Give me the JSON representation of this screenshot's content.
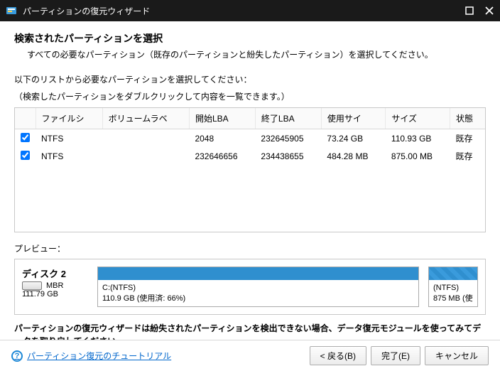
{
  "titlebar": {
    "title": "パーティションの復元ウィザード"
  },
  "header": {
    "heading": "検索されたパーティションを選択",
    "subheading": "すべての必要なパーティション（既存のパーティションと紛失したパーティション）を選択してください。"
  },
  "instruction": {
    "line1": "以下のリストから必要なパーティションを選択してください：",
    "line2": "（検索したパーティションをダブルクリックして内容を一覧できます。）"
  },
  "table": {
    "headers": [
      "ファイルシ",
      "ボリュームラベ",
      "開始LBA",
      "終了LBA",
      "使用サイ",
      "サイズ",
      "状態"
    ],
    "rows": [
      {
        "checked": true,
        "fs": "NTFS",
        "label": "",
        "start": "2048",
        "end": "232645905",
        "used": "73.24 GB",
        "size": "110.93 GB",
        "status": "既存"
      },
      {
        "checked": true,
        "fs": "NTFS",
        "label": "",
        "start": "232646656",
        "end": "234438655",
        "used": "484.28 MB",
        "size": "875.00 MB",
        "status": "既存"
      }
    ]
  },
  "preview": {
    "label": "プレビュー：",
    "disk": {
      "name": "ディスク 2",
      "type": "MBR",
      "size": "111.79 GB"
    },
    "partitions": [
      {
        "title": "C:(NTFS)",
        "detail": "110.9 GB (使用済: 66%)"
      },
      {
        "title": "(NTFS)",
        "detail": "875 MB (使"
      }
    ]
  },
  "note": "パーティションの復元ウィザードは紛失されたパーティションを検出できない場合、データ復元モジュールを使ってみてデータを取り戻してください。",
  "footer": {
    "help": "パーティション復元のチュートリアル",
    "back": "< 戻る(B)",
    "finish": "完了(E)",
    "cancel": "キャンセル"
  }
}
